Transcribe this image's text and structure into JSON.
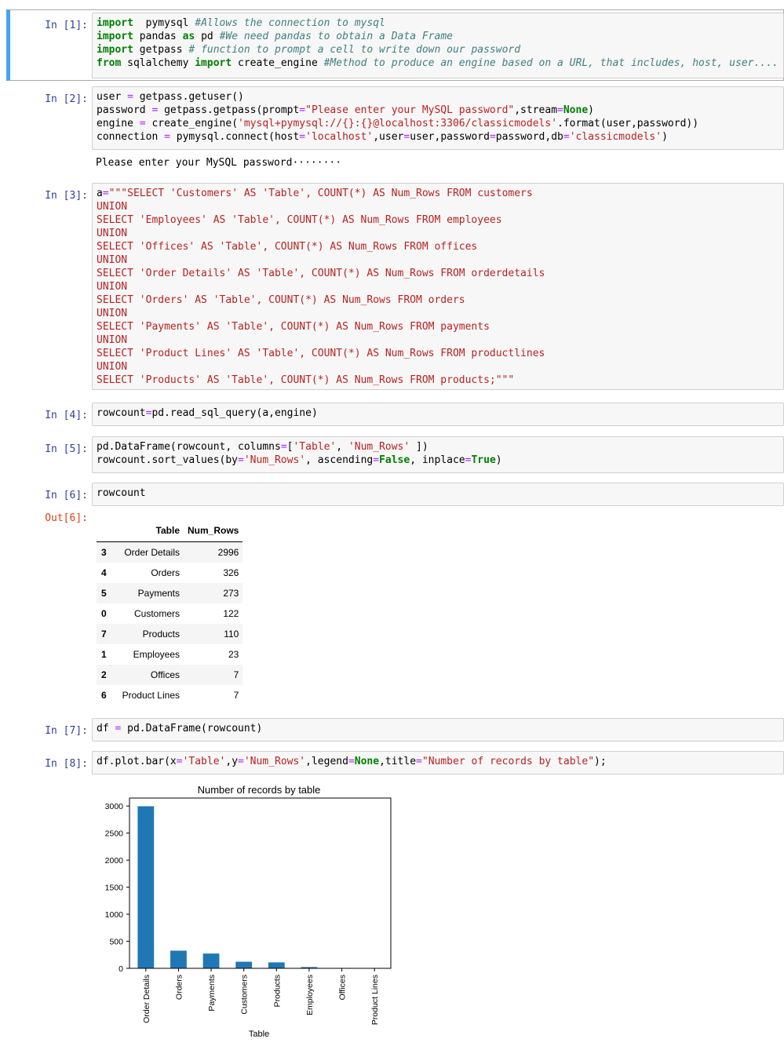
{
  "cells": [
    {
      "prompt": "In [1]:"
    },
    {
      "prompt": "In [2]:",
      "output": "Please enter your MySQL password········"
    },
    {
      "prompt": "In [3]:"
    },
    {
      "prompt": "In [4]:"
    },
    {
      "prompt": "In [5]:"
    },
    {
      "prompt": "In [6]:",
      "out_prompt": "Out[6]:"
    },
    {
      "prompt": "In [7]:"
    },
    {
      "prompt": "In [8]:"
    }
  ],
  "code": {
    "c1": [
      [
        [
          "kw",
          "import"
        ],
        [
          "",
          "  pymysql "
        ],
        [
          "cm",
          "#Allows the connection to mysql"
        ]
      ],
      [
        [
          "kw",
          "import"
        ],
        [
          "",
          " pandas "
        ],
        [
          "kw",
          "as"
        ],
        [
          "",
          " pd "
        ],
        [
          "cm",
          "#We need pandas to obtain a Data Frame"
        ]
      ],
      [
        [
          "kw",
          "import"
        ],
        [
          "",
          " getpass "
        ],
        [
          "cm",
          "# function to prompt a cell to write down our password"
        ]
      ],
      [
        [
          "kw",
          "from"
        ],
        [
          "",
          " sqlalchemy "
        ],
        [
          "kw",
          "import"
        ],
        [
          "",
          " create_engine "
        ],
        [
          "cm",
          "#Method to produce an engine based on a URL, that includes, host, user...."
        ]
      ]
    ],
    "c2": [
      [
        [
          "",
          "user "
        ],
        [
          "op",
          "="
        ],
        [
          "",
          " getpass.getuser()"
        ]
      ],
      [
        [
          "",
          "password "
        ],
        [
          "op",
          "="
        ],
        [
          "",
          " getpass.getpass(prompt"
        ],
        [
          "op",
          "="
        ],
        [
          "st",
          "\"Please enter your MySQL password\""
        ],
        [
          "",
          ",stream"
        ],
        [
          "op",
          "="
        ],
        [
          "kw",
          "None"
        ],
        [
          "",
          ")"
        ]
      ],
      [
        [
          "",
          "engine "
        ],
        [
          "op",
          "="
        ],
        [
          "",
          " create_engine("
        ],
        [
          "st",
          "'mysql+pymysql://{}:{}@localhost:3306/classicmodels'"
        ],
        [
          "",
          ".format(user,password))"
        ]
      ],
      [
        [
          "",
          "connection "
        ],
        [
          "op",
          "="
        ],
        [
          "",
          " pymysql.connect(host"
        ],
        [
          "op",
          "="
        ],
        [
          "st",
          "'localhost'"
        ],
        [
          "",
          ",user"
        ],
        [
          "op",
          "="
        ],
        [
          "",
          "user,password"
        ],
        [
          "op",
          "="
        ],
        [
          "",
          "password,db"
        ],
        [
          "op",
          "="
        ],
        [
          "st",
          "'classicmodels'"
        ],
        [
          "",
          ")"
        ]
      ]
    ],
    "c3": [
      [
        [
          "",
          "a"
        ],
        [
          "op",
          "="
        ],
        [
          "st",
          "\"\"\"SELECT 'Customers' AS 'Table', COUNT(*) AS Num_Rows FROM customers"
        ]
      ],
      [
        [
          "st",
          "UNION"
        ]
      ],
      [
        [
          "st",
          "SELECT 'Employees' AS 'Table', COUNT(*) AS Num_Rows FROM employees"
        ]
      ],
      [
        [
          "st",
          "UNION"
        ]
      ],
      [
        [
          "st",
          "SELECT 'Offices' AS 'Table', COUNT(*) AS Num_Rows FROM offices"
        ]
      ],
      [
        [
          "st",
          "UNION"
        ]
      ],
      [
        [
          "st",
          "SELECT 'Order Details' AS 'Table', COUNT(*) AS Num_Rows FROM orderdetails"
        ]
      ],
      [
        [
          "st",
          "UNION"
        ]
      ],
      [
        [
          "st",
          "SELECT 'Orders' AS 'Table', COUNT(*) AS Num_Rows FROM orders"
        ]
      ],
      [
        [
          "st",
          "UNION"
        ]
      ],
      [
        [
          "st",
          "SELECT 'Payments' AS 'Table', COUNT(*) AS Num_Rows FROM payments"
        ]
      ],
      [
        [
          "st",
          "UNION"
        ]
      ],
      [
        [
          "st",
          "SELECT 'Product Lines' AS 'Table', COUNT(*) AS Num_Rows FROM productlines"
        ]
      ],
      [
        [
          "st",
          "UNION"
        ]
      ],
      [
        [
          "st",
          "SELECT 'Products' AS 'Table', COUNT(*) AS Num_Rows FROM products;\"\"\""
        ]
      ]
    ],
    "c4": [
      [
        [
          "",
          "rowcount"
        ],
        [
          "op",
          "="
        ],
        [
          "",
          "pd.read_sql_query(a,engine)"
        ]
      ]
    ],
    "c5": [
      [
        [
          "",
          "pd.DataFrame(rowcount, columns"
        ],
        [
          "op",
          "="
        ],
        [
          "",
          "["
        ],
        [
          "st",
          "'Table'"
        ],
        [
          "",
          ", "
        ],
        [
          "st",
          "'Num_Rows'"
        ],
        [
          "",
          " ])"
        ]
      ],
      [
        [
          "",
          "rowcount.sort_values(by"
        ],
        [
          "op",
          "="
        ],
        [
          "st",
          "'Num_Rows'"
        ],
        [
          "",
          ", ascending"
        ],
        [
          "op",
          "="
        ],
        [
          "kw",
          "False"
        ],
        [
          "",
          ", inplace"
        ],
        [
          "op",
          "="
        ],
        [
          "kw",
          "True"
        ],
        [
          "",
          ")"
        ]
      ]
    ],
    "c6": [
      [
        [
          "",
          "rowcount"
        ]
      ]
    ],
    "c7": [
      [
        [
          "",
          "df "
        ],
        [
          "op",
          "="
        ],
        [
          "",
          " pd.DataFrame(rowcount)"
        ]
      ]
    ],
    "c8": [
      [
        [
          "",
          "df.plot.bar(x"
        ],
        [
          "op",
          "="
        ],
        [
          "st",
          "'Table'"
        ],
        [
          "",
          ",y"
        ],
        [
          "op",
          "="
        ],
        [
          "st",
          "'Num_Rows'"
        ],
        [
          "",
          ",legend"
        ],
        [
          "op",
          "="
        ],
        [
          "kw",
          "None"
        ],
        [
          "",
          ",title"
        ],
        [
          "op",
          "="
        ],
        [
          "st",
          "\"Number of records by table\""
        ],
        [
          "",
          ");"
        ]
      ]
    ]
  },
  "dataframe": {
    "columns": [
      "Table",
      "Num_Rows"
    ],
    "rows": [
      {
        "index": "3",
        "table": "Order Details",
        "num_rows": "2996"
      },
      {
        "index": "4",
        "table": "Orders",
        "num_rows": "326"
      },
      {
        "index": "5",
        "table": "Payments",
        "num_rows": "273"
      },
      {
        "index": "0",
        "table": "Customers",
        "num_rows": "122"
      },
      {
        "index": "7",
        "table": "Products",
        "num_rows": "110"
      },
      {
        "index": "1",
        "table": "Employees",
        "num_rows": "23"
      },
      {
        "index": "2",
        "table": "Offices",
        "num_rows": "7"
      },
      {
        "index": "6",
        "table": "Product Lines",
        "num_rows": "7"
      }
    ]
  },
  "chart_data": {
    "type": "bar",
    "title": "Number of records by table",
    "xlabel": "Table",
    "ylabel": "",
    "categories": [
      "Order Details",
      "Orders",
      "Payments",
      "Customers",
      "Products",
      "Employees",
      "Offices",
      "Product Lines"
    ],
    "values": [
      2996,
      326,
      273,
      122,
      110,
      23,
      7,
      7
    ],
    "ylim": [
      0,
      3148
    ],
    "yticks": [
      0,
      500,
      1000,
      1500,
      2000,
      2500,
      3000
    ],
    "bar_color": "#1f77b4",
    "legend": "none",
    "grid": false
  },
  "colors": {
    "in_prompt": "#303f9f",
    "out_prompt": "#d84315",
    "keyword": "#008000",
    "comment": "#408080",
    "string": "#ba2121",
    "operator": "#aa22ff",
    "selected_cell_bar": "#42a5f5"
  }
}
